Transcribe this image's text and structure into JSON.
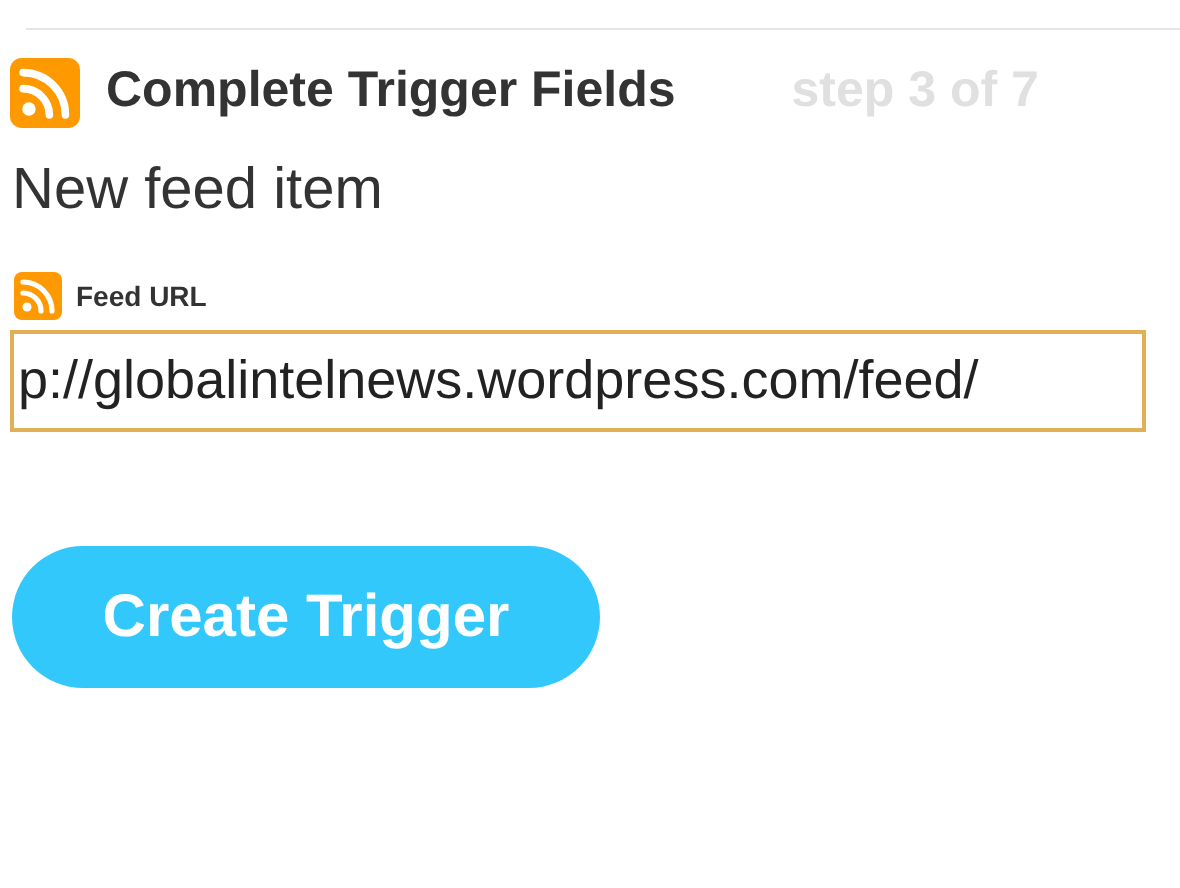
{
  "header": {
    "title": "Complete Trigger Fields",
    "step": "step 3 of 7"
  },
  "trigger_name": "New feed item",
  "field": {
    "label": "Feed URL",
    "value": "p://globalintelnews.wordpress.com/feed/"
  },
  "button": "Create Trigger"
}
